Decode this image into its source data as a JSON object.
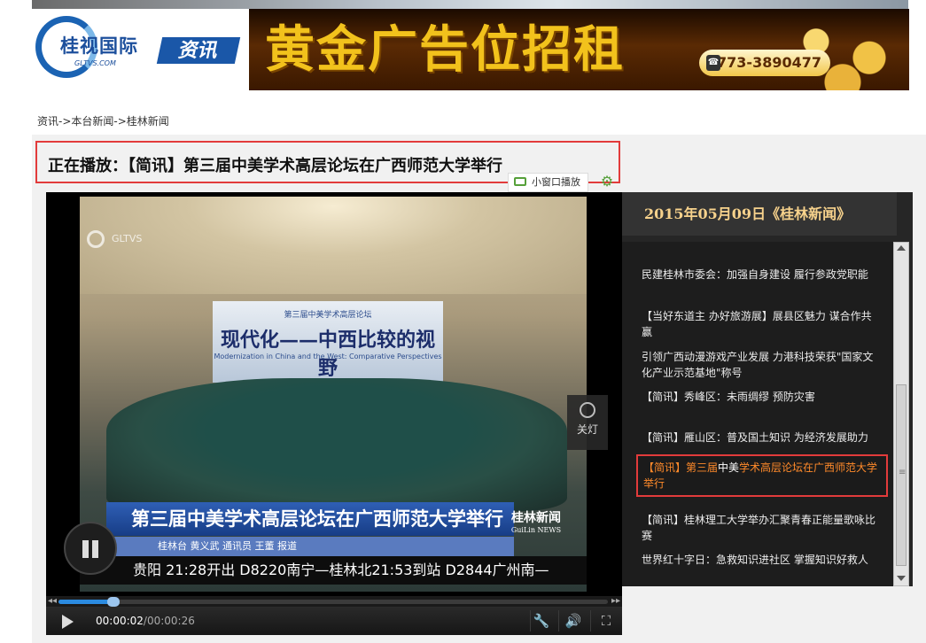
{
  "header": {
    "logo_text": "桂视国际",
    "logo_sub": "GLTVS.COM",
    "logo_tag": "资讯",
    "ad_title": "黄金广告位招租",
    "ad_phone": "0773-3890477"
  },
  "breadcrumb": "资讯->本台新闻->桂林新闻",
  "now_playing": "正在播放：【简讯】第三届中美学术高层论坛在广西师范大学举行",
  "toolbar": {
    "mini_play_label": "小窗口播放"
  },
  "video": {
    "watermark": "GLTVS",
    "banner_small": "第三届中美学术高层论坛",
    "banner_big": "现代化——中西比较的视野",
    "banner_en": "Modernization in China and the West: Comparative Perspectives",
    "caption": "第三届中美学术高层论坛在广西师范大学举行",
    "reporters": "桂林台  黄义武  通讯员  王董  报道",
    "news_logo": "桂林新闻",
    "news_logo_en": "GuiLin NEWS",
    "ticker": "贵阳  21:28开出    D8220南宁—桂林北21:53到站    D2844广州南—"
  },
  "lamp_label": "关灯",
  "player": {
    "time_current": "00:00:02",
    "time_total": "/00:00:26",
    "progress_fraction": 0.1
  },
  "playlist": {
    "header": "2015年05月09日《桂林新闻》",
    "items": [
      {
        "text": "民建桂林市委会：加强自身建设 履行参政党职能"
      },
      {
        "text": "【当好东道主 办好旅游展】展县区魅力 谋合作共赢"
      },
      {
        "text": "引领广西动漫游戏产业发展 力港科技荣获\"国家文化产业示范基地\"称号"
      },
      {
        "text": "【简讯】秀峰区：未雨绸缪 预防灾害"
      },
      {
        "text": "【简讯】雁山区：普及国土知识 为经济发展助力"
      },
      {
        "text_a": "【简讯】第三届",
        "text_b": "中美",
        "text_c": "学术高层论坛在广西师范大学举行"
      },
      {
        "text": "【简讯】桂林理工大学举办汇聚青春正能量歌咏比赛"
      },
      {
        "text": "世界红十字日：急救知识进社区 掌握知识好救人"
      }
    ]
  },
  "colors": {
    "highlight_border": "#e23b3b",
    "active_item": "#ff8a2a",
    "playlist_header": "#f7d28c",
    "progress": "#2b8be0"
  }
}
